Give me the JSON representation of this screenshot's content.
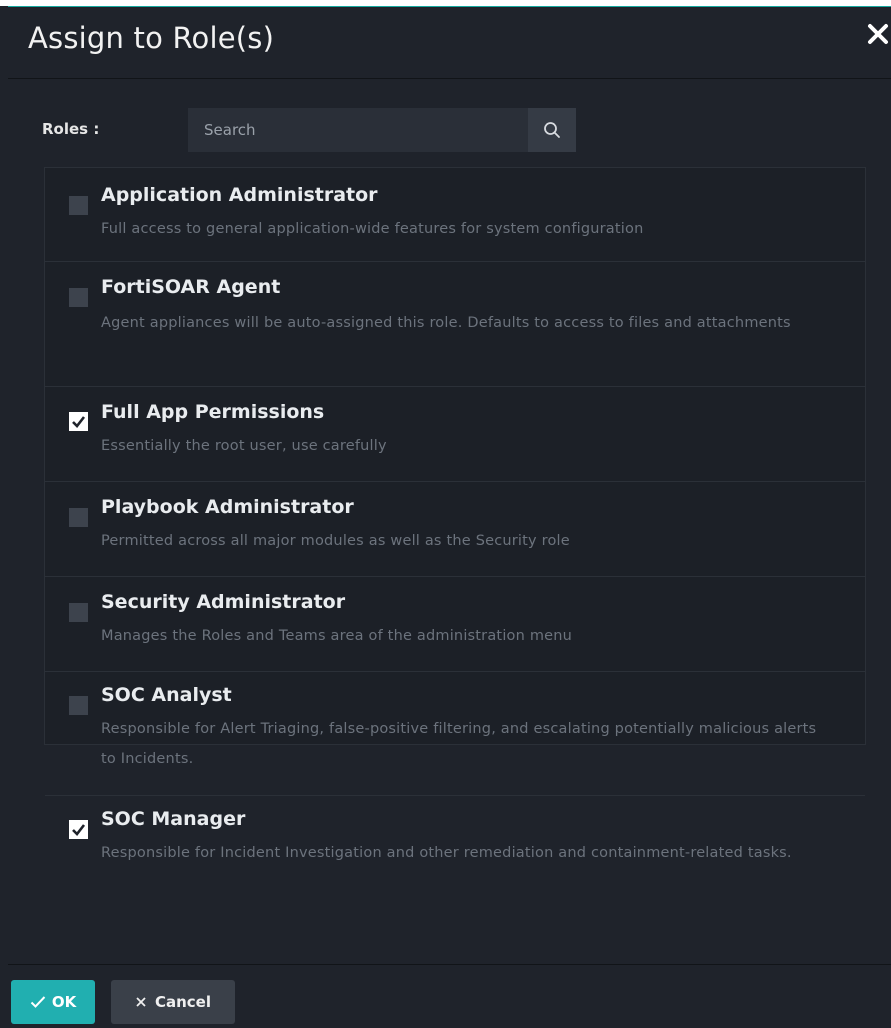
{
  "dialog": {
    "title": "Assign to Role(s)"
  },
  "search": {
    "label": "Roles :",
    "placeholder": "Search"
  },
  "roles": [
    {
      "name": "Application Administrator",
      "description": "Full access to general application-wide features for system configuration",
      "checked": false
    },
    {
      "name": "FortiSOAR Agent",
      "description": "Agent appliances will be auto-assigned this role. Defaults to access to files and attachments",
      "checked": false
    },
    {
      "name": "Full App Permissions",
      "description": "Essentially the root user, use carefully",
      "checked": true
    },
    {
      "name": "Playbook Administrator",
      "description": "Permitted across all major modules as well as the Security role",
      "checked": false
    },
    {
      "name": "Security Administrator",
      "description": "Manages the Roles and Teams area of the administration menu",
      "checked": false
    },
    {
      "name": "SOC Analyst",
      "description": "Responsible for Alert Triaging, false-positive filtering, and escalating potentially malicious alerts to Incidents.",
      "checked": false
    },
    {
      "name": "SOC Manager",
      "description": "Responsible for Incident Investigation and other remediation and containment-related tasks.",
      "checked": true
    }
  ],
  "footer": {
    "ok_label": "OK",
    "cancel_label": "Cancel"
  },
  "icons": {
    "close": "close-icon",
    "search": "search-icon",
    "ok": "check-icon",
    "cancel": "x-icon"
  },
  "colors": {
    "background": "#1f232b",
    "accent": "#21afb0",
    "checkbox_checked": "#ffffff",
    "checkbox_unchecked": "#3d434d"
  }
}
